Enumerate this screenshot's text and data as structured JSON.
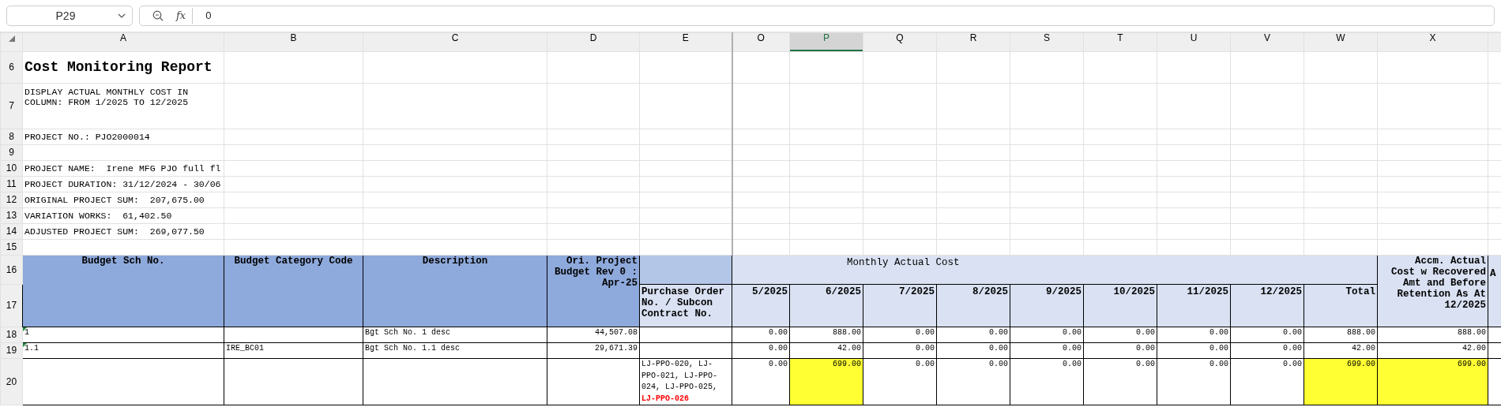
{
  "name_box": {
    "value": "P29"
  },
  "formula_bar": {
    "function_label": "fx",
    "value": "0"
  },
  "column_headers": [
    {
      "label": "A",
      "selected": false
    },
    {
      "label": "B",
      "selected": false
    },
    {
      "label": "C",
      "selected": false
    },
    {
      "label": "D",
      "selected": false
    },
    {
      "label": "E",
      "selected": false
    },
    {
      "label": "O",
      "selected": false
    },
    {
      "label": "P",
      "selected": true
    },
    {
      "label": "Q",
      "selected": false
    },
    {
      "label": "R",
      "selected": false
    },
    {
      "label": "S",
      "selected": false
    },
    {
      "label": "T",
      "selected": false
    },
    {
      "label": "U",
      "selected": false
    },
    {
      "label": "V",
      "selected": false
    },
    {
      "label": "W",
      "selected": false
    },
    {
      "label": "X",
      "selected": false
    }
  ],
  "rows": [
    {
      "number": "6",
      "kind": "title",
      "text": "Cost Monitoring Report"
    },
    {
      "number": "7",
      "kind": "note",
      "text": "DISPLAY ACTUAL MONTHLY COST IN COLUMN: FROM 1/2025 TO 12/2025"
    },
    {
      "number": "8",
      "kind": "info",
      "text": "PROJECT NO.: PJO2000014"
    },
    {
      "number": "9",
      "kind": "blank"
    },
    {
      "number": "10",
      "kind": "info",
      "text": "PROJECT NAME:  Irene MFG PJO full fl"
    },
    {
      "number": "11",
      "kind": "info",
      "text": "PROJECT DURATION: 31/12/2024 - 30/06"
    },
    {
      "number": "12",
      "kind": "info",
      "text": "ORIGINAL PROJECT SUM:  207,675.00"
    },
    {
      "number": "13",
      "kind": "info",
      "text": "VARIATION WORKS:  61,402.50"
    },
    {
      "number": "14",
      "kind": "info",
      "text": "ADJUSTED PROJECT SUM:  269,077.50"
    },
    {
      "number": "15",
      "kind": "blank"
    },
    {
      "number": "16",
      "kind": "header_top"
    },
    {
      "number": "17",
      "kind": "header_bottom"
    },
    {
      "number": "18",
      "kind": "data",
      "note_marker": true,
      "sch_no": "1",
      "description": "Bgt Sch No. 1 desc",
      "budget": "44,507.08",
      "amounts": [
        {
          "text": "0.00",
          "highlighted": false
        },
        {
          "text": "888.00",
          "highlighted": false
        },
        {
          "text": "0.00",
          "highlighted": false
        },
        {
          "text": "0.00",
          "highlighted": false
        },
        {
          "text": "0.00",
          "highlighted": false
        },
        {
          "text": "0.00",
          "highlighted": false
        },
        {
          "text": "0.00",
          "highlighted": false
        },
        {
          "text": "0.00",
          "highlighted": false
        },
        {
          "text": "888.00",
          "highlighted": false
        }
      ],
      "accm": {
        "text": "888.00",
        "highlighted": false
      }
    },
    {
      "number": "19",
      "kind": "data",
      "note_marker": true,
      "sch_no": "1.1",
      "category_code": "IRE_BC01",
      "description": "Bgt Sch No. 1.1 desc",
      "budget": "29,671.39",
      "amounts": [
        {
          "text": "0.00",
          "highlighted": false
        },
        {
          "text": "42.00",
          "highlighted": false
        },
        {
          "text": "0.00",
          "highlighted": false
        },
        {
          "text": "0.00",
          "highlighted": false
        },
        {
          "text": "0.00",
          "highlighted": false
        },
        {
          "text": "0.00",
          "highlighted": false
        },
        {
          "text": "0.00",
          "highlighted": false
        },
        {
          "text": "0.00",
          "highlighted": false
        },
        {
          "text": "42.00",
          "highlighted": false
        }
      ],
      "accm": {
        "text": "42.00",
        "highlighted": false
      }
    },
    {
      "number": "20",
      "kind": "data",
      "note_marker": false,
      "po_numbers": [
        {
          "text": "LJ-PPO-020, LJ-PPO-021, LJ-PPO-024, LJ-PPO-025,",
          "flagged": false
        },
        {
          "text": "LJ-PPO-026",
          "flagged": true
        }
      ],
      "amounts": [
        {
          "text": "0.00",
          "highlighted": false
        },
        {
          "text": "699.00",
          "highlighted": true
        },
        {
          "text": "0.00",
          "highlighted": false
        },
        {
          "text": "0.00",
          "highlighted": false
        },
        {
          "text": "0.00",
          "highlighted": false
        },
        {
          "text": "0.00",
          "highlighted": false
        },
        {
          "text": "0.00",
          "highlighted": false
        },
        {
          "text": "0.00",
          "highlighted": false
        },
        {
          "text": "699.00",
          "highlighted": true
        }
      ],
      "accm": {
        "text": "699.00",
        "highlighted": true
      }
    }
  ],
  "table_header": {
    "sch_no": "Budget Sch No.",
    "category_code": "Budget Category Code",
    "description": "Description",
    "budget": "Ori. Project Budget Rev 0 : Apr-25",
    "po_numbers": "Purchase Order No. / Subcon Contract No.",
    "monthly_group": "Monthly Actual Cost",
    "amount_columns": [
      "5/2025",
      "6/2025",
      "7/2025",
      "8/2025",
      "9/2025",
      "10/2025",
      "11/2025",
      "12/2025",
      "Total"
    ],
    "accm": "Accm. Actual Cost w Recovered Amt and Before Retention As At 12/2025",
    "cut_column": "A"
  }
}
